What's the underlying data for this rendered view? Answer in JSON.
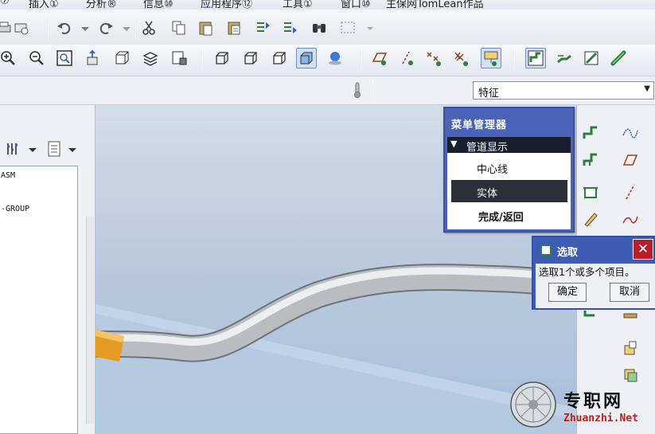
{
  "menubar": {
    "items": [
      "⑦",
      "插入①",
      "分析®",
      "信息⑩",
      "应用程序⑫",
      "工具①",
      "窗口⑩",
      "主保网TomLean作品"
    ]
  },
  "toolbar_top": {
    "icons": [
      "print-icon",
      "undo-icon",
      "redo-icon",
      "cut-icon",
      "copy-icon",
      "paste-icon",
      "paste-special-icon",
      "regenerate-icon",
      "regenerate-manager-icon",
      "find-icon",
      "select-box-icon",
      "datum-plane-display-icon",
      "datum-axis-display-icon",
      "datum-point-display-icon",
      "coordinate-system-display-icon",
      "annotation-display-icon"
    ]
  },
  "toolbar_view": {
    "icons": [
      "zoom-in-icon",
      "zoom-out-icon",
      "refit-icon",
      "reorient-icon",
      "saved-views-icon",
      "layers-icon",
      "view-manager-icon",
      "wireframe-icon",
      "hidden-line-icon",
      "no-hidden-icon",
      "shading-icon",
      "enhanced-realism-icon"
    ]
  },
  "toolbar_right_top": {
    "icons": [
      "piping-route-icon",
      "piping-insert-icon",
      "piping-edit-icon",
      "piping-pipe-icon"
    ]
  },
  "filter": {
    "value": "特征"
  },
  "model_tree": {
    "nodes": [
      "ASM",
      "-GROUP"
    ]
  },
  "menu_manager": {
    "title": "菜单管理器",
    "section": "管道显示",
    "items": [
      "中心线",
      "实体",
      "完成/返回"
    ],
    "selected_index": 1
  },
  "select_dialog": {
    "title": "选取",
    "close": "✕",
    "message": "选取1个或多个项目。",
    "ok_label": "确定",
    "cancel_label": "取消"
  },
  "right_toolbar": {
    "icons": [
      "pipe-route-icon",
      "curve-icon",
      "pipe-branch-icon",
      "datum-plane-icon",
      "pipe-fitting-icon",
      "datum-axis-icon",
      "sketch-icon",
      "spline-icon",
      "pipe-connect-icon",
      "layer-icon",
      "view-icon",
      "datum-point-icon"
    ]
  },
  "watermark": {
    "name": "专职网",
    "url": "Zhuanzhi.Net"
  },
  "colors": {
    "dialog_blue": "#4a63b8",
    "pipe_gray": "#b9bdc1",
    "pipe_end_orange": "#e39b22",
    "viewport_bg": "#b7cae0"
  }
}
